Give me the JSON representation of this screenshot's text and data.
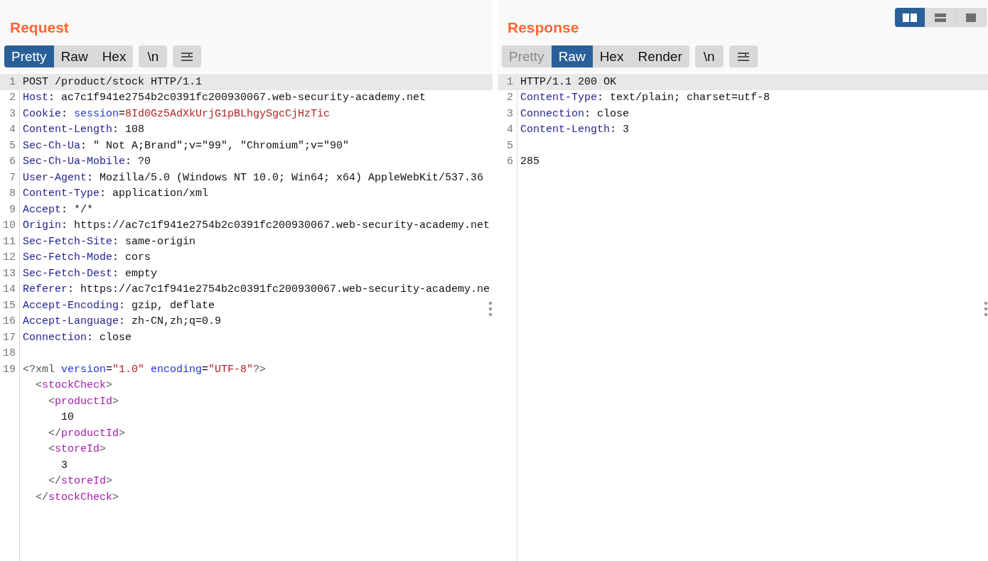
{
  "layout_buttons": [
    {
      "kind": "side-by-side",
      "selected": true
    },
    {
      "kind": "top-bottom",
      "selected": false
    },
    {
      "kind": "single",
      "selected": false
    }
  ],
  "panes": [
    {
      "title": "Request",
      "tabs": [
        {
          "label": "Pretty",
          "selected": true,
          "disabled": false
        },
        {
          "label": "Raw",
          "selected": false,
          "disabled": false
        },
        {
          "label": "Hex",
          "selected": false,
          "disabled": false
        }
      ],
      "newline_toggle": "\\n",
      "lines": [
        {
          "number": "1",
          "highlighted": true,
          "segments": [
            {
              "kind": "text",
              "text": "POST /product/stock HTTP/1.1"
            }
          ]
        },
        {
          "number": "2",
          "highlighted": false,
          "segments": [
            {
              "kind": "key",
              "text": "Host"
            },
            {
              "kind": "text",
              "text": ": ac7c1f941e2754b2c0391fc200930067.web-security-academy.net"
            }
          ]
        },
        {
          "number": "3",
          "highlighted": false,
          "segments": [
            {
              "kind": "key",
              "text": "Cookie"
            },
            {
              "kind": "text",
              "text": ": "
            },
            {
              "kind": "param",
              "text": "session"
            },
            {
              "kind": "text",
              "text": "="
            },
            {
              "kind": "value",
              "text": "8Id0Gz5AdXkUrjG1pBLhgySgcCjHzTic"
            }
          ]
        },
        {
          "number": "4",
          "highlighted": false,
          "segments": [
            {
              "kind": "key",
              "text": "Content-Length"
            },
            {
              "kind": "text",
              "text": ": 108"
            }
          ]
        },
        {
          "number": "5",
          "highlighted": false,
          "segments": [
            {
              "kind": "key",
              "text": "Sec-Ch-Ua"
            },
            {
              "kind": "text",
              "text": ": \" Not A;Brand\";v=\"99\", \"Chromium\";v=\"90\""
            }
          ]
        },
        {
          "number": "6",
          "highlighted": false,
          "segments": [
            {
              "kind": "key",
              "text": "Sec-Ch-Ua-Mobile"
            },
            {
              "kind": "text",
              "text": ": ?0"
            }
          ]
        },
        {
          "number": "7",
          "highlighted": false,
          "segments": [
            {
              "kind": "key",
              "text": "User-Agent"
            },
            {
              "kind": "text",
              "text": ": Mozilla/5.0 (Windows NT 10.0; Win64; x64) AppleWebKit/537.36"
            }
          ]
        },
        {
          "number": "8",
          "highlighted": false,
          "segments": [
            {
              "kind": "key",
              "text": "Content-Type"
            },
            {
              "kind": "text",
              "text": ": application/xml"
            }
          ]
        },
        {
          "number": "9",
          "highlighted": false,
          "segments": [
            {
              "kind": "key",
              "text": "Accept"
            },
            {
              "kind": "text",
              "text": ": */*"
            }
          ]
        },
        {
          "number": "10",
          "highlighted": false,
          "segments": [
            {
              "kind": "key",
              "text": "Origin"
            },
            {
              "kind": "text",
              "text": ": https://ac7c1f941e2754b2c0391fc200930067.web-security-academy.net"
            }
          ]
        },
        {
          "number": "11",
          "highlighted": false,
          "segments": [
            {
              "kind": "key",
              "text": "Sec-Fetch-Site"
            },
            {
              "kind": "text",
              "text": ": same-origin"
            }
          ]
        },
        {
          "number": "12",
          "highlighted": false,
          "segments": [
            {
              "kind": "key",
              "text": "Sec-Fetch-Mode"
            },
            {
              "kind": "text",
              "text": ": cors"
            }
          ]
        },
        {
          "number": "13",
          "highlighted": false,
          "segments": [
            {
              "kind": "key",
              "text": "Sec-Fetch-Dest"
            },
            {
              "kind": "text",
              "text": ": empty"
            }
          ]
        },
        {
          "number": "14",
          "highlighted": false,
          "segments": [
            {
              "kind": "key",
              "text": "Referer"
            },
            {
              "kind": "text",
              "text": ": https://ac7c1f941e2754b2c0391fc200930067.web-security-academy.ne"
            }
          ]
        },
        {
          "number": "15",
          "highlighted": false,
          "segments": [
            {
              "kind": "key",
              "text": "Accept-Encoding"
            },
            {
              "kind": "text",
              "text": ": gzip, deflate"
            }
          ]
        },
        {
          "number": "16",
          "highlighted": false,
          "segments": [
            {
              "kind": "key",
              "text": "Accept-Language"
            },
            {
              "kind": "text",
              "text": ": zh-CN,zh;q=0.9"
            }
          ]
        },
        {
          "number": "17",
          "highlighted": false,
          "segments": [
            {
              "kind": "key",
              "text": "Connection"
            },
            {
              "kind": "text",
              "text": ": close"
            }
          ]
        },
        {
          "number": "18",
          "highlighted": false
        },
        {
          "number": "19",
          "highlighted": false,
          "segments": [
            {
              "kind": "punct",
              "text": "<?xml"
            },
            {
              "kind": "param",
              "text": " version"
            },
            {
              "kind": "text",
              "text": "="
            },
            {
              "kind": "value",
              "text": "\"1.0\""
            },
            {
              "kind": "param",
              "text": " encoding"
            },
            {
              "kind": "text",
              "text": "="
            },
            {
              "kind": "value",
              "text": "\"UTF-8\""
            },
            {
              "kind": "punct",
              "text": "?>"
            }
          ]
        },
        {
          "highlighted": false,
          "segments": [
            {
              "kind": "punct",
              "text": "  <"
            },
            {
              "kind": "tag",
              "text": "stockCheck"
            },
            {
              "kind": "punct",
              "text": ">"
            }
          ]
        },
        {
          "highlighted": false,
          "segments": [
            {
              "kind": "punct",
              "text": "    <"
            },
            {
              "kind": "tag",
              "text": "productId"
            },
            {
              "kind": "punct",
              "text": ">"
            }
          ]
        },
        {
          "highlighted": false,
          "segments": [
            {
              "kind": "text",
              "text": "      10"
            }
          ]
        },
        {
          "highlighted": false,
          "segments": [
            {
              "kind": "punct",
              "text": "    </"
            },
            {
              "kind": "tag",
              "text": "productId"
            },
            {
              "kind": "punct",
              "text": ">"
            }
          ]
        },
        {
          "highlighted": false,
          "segments": [
            {
              "kind": "punct",
              "text": "    <"
            },
            {
              "kind": "tag",
              "text": "storeId"
            },
            {
              "kind": "punct",
              "text": ">"
            }
          ]
        },
        {
          "highlighted": false,
          "segments": [
            {
              "kind": "text",
              "text": "      3"
            }
          ]
        },
        {
          "highlighted": false,
          "segments": [
            {
              "kind": "punct",
              "text": "    </"
            },
            {
              "kind": "tag",
              "text": "storeId"
            },
            {
              "kind": "punct",
              "text": ">"
            }
          ]
        },
        {
          "highlighted": false,
          "segments": [
            {
              "kind": "punct",
              "text": "  </"
            },
            {
              "kind": "tag",
              "text": "stockCheck"
            },
            {
              "kind": "punct",
              "text": ">"
            }
          ]
        }
      ]
    },
    {
      "title": "Response",
      "tabs": [
        {
          "label": "Pretty",
          "selected": false,
          "disabled": true
        },
        {
          "label": "Raw",
          "selected": true,
          "disabled": false
        },
        {
          "label": "Hex",
          "selected": false,
          "disabled": false
        },
        {
          "label": "Render",
          "selected": false,
          "disabled": false
        }
      ],
      "newline_toggle": "\\n",
      "lines": [
        {
          "number": "1",
          "highlighted": true,
          "segments": [
            {
              "kind": "text",
              "text": "HTTP/1.1 200 OK"
            }
          ]
        },
        {
          "number": "2",
          "highlighted": false,
          "segments": [
            {
              "kind": "key",
              "text": "Content-Type"
            },
            {
              "kind": "text",
              "text": ": text/plain; charset=utf-8"
            }
          ]
        },
        {
          "number": "3",
          "highlighted": false,
          "segments": [
            {
              "kind": "key",
              "text": "Connection"
            },
            {
              "kind": "text",
              "text": ": close"
            }
          ]
        },
        {
          "number": "4",
          "highlighted": false,
          "segments": [
            {
              "kind": "key",
              "text": "Content-Length"
            },
            {
              "kind": "text",
              "text": ": 3"
            }
          ]
        },
        {
          "number": "5",
          "highlighted": false
        },
        {
          "number": "6",
          "highlighted": false,
          "segments": [
            {
              "kind": "text",
              "text": "285"
            }
          ]
        }
      ]
    }
  ]
}
